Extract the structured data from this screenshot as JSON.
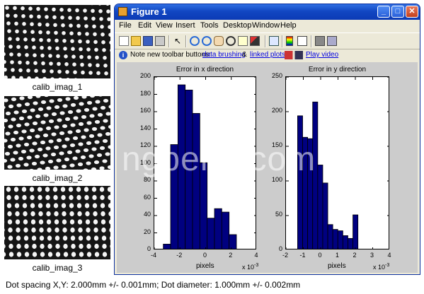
{
  "thumbnails": [
    {
      "caption": "calib_imag_1"
    },
    {
      "caption": "calib_imag_2"
    },
    {
      "caption": "calib_imag_3"
    }
  ],
  "caption": "Dot spacing X,Y: 2.000mm +/- 0.001mm;  Dot diameter: 1.000mm +/- 0.002mm",
  "watermark": "ngpeng.com",
  "window": {
    "title": "Figure 1",
    "controls": {
      "minimize": "_",
      "maximize": "□",
      "close": "✕"
    },
    "menu": [
      "File",
      "Edit",
      "View",
      "Insert",
      "Tools",
      "Desktop",
      "Window",
      "Help"
    ],
    "toolbar_icons": [
      "new-file-icon",
      "open-folder-icon",
      "save-icon",
      "print-icon",
      "pointer-icon",
      "zoom-in-icon",
      "zoom-out-icon",
      "pan-hand-icon",
      "rotate-3d-icon",
      "data-cursor-icon",
      "brush-icon",
      "link-icon",
      "colorbar-icon",
      "legend-icon",
      "hide-plot-tools-icon",
      "show-plot-tools-icon"
    ],
    "note": {
      "prefix": "Note new toolbar buttons: ",
      "link1": "data brushing",
      "amp": " & ",
      "link2": "linked plots",
      "video": "Play video"
    }
  },
  "colors": {
    "bar_fill": "#000080",
    "bar_edge": "#000000",
    "figure_bg": "#cccccc",
    "titlebar": "#1247c2"
  },
  "chart_data": [
    {
      "type": "bar",
      "title": "Error in x direction",
      "xlabel": "pixels",
      "ylabel": "",
      "x_multiplier": "x 10",
      "x_multiplier_exp": "-3",
      "xlim": [
        -4,
        4
      ],
      "ylim": [
        0,
        200
      ],
      "xticks": [
        "-4",
        "-2",
        "0",
        "2",
        "4"
      ],
      "yticks": [
        "0",
        "20",
        "40",
        "60",
        "80",
        "100",
        "120",
        "140",
        "160",
        "180",
        "200"
      ],
      "bin_edges": [
        -3.3,
        -2.73,
        -2.16,
        -1.59,
        -1.02,
        -0.45,
        0.12,
        0.69,
        1.26,
        1.83
      ],
      "values": [
        7,
        122,
        191,
        185,
        158,
        101,
        37,
        48,
        44,
        18
      ]
    },
    {
      "type": "bar",
      "title": "Error in y direction",
      "xlabel": "pixels",
      "ylabel": "",
      "x_multiplier": "x 10",
      "x_multiplier_exp": "-3",
      "xlim": [
        -2,
        4
      ],
      "ylim": [
        0,
        250
      ],
      "xticks": [
        "-2",
        "-1",
        "0",
        "1",
        "2",
        "3",
        "4"
      ],
      "yticks": [
        "0",
        "50",
        "100",
        "150",
        "200",
        "250"
      ],
      "bin_edges": [
        -1.33,
        -1.04,
        -0.75,
        -0.46,
        -0.17,
        0.12,
        0.41,
        0.7,
        0.99,
        1.28,
        1.57,
        1.86,
        2.15,
        2.44
      ],
      "values": [
        194,
        163,
        161,
        214,
        123,
        97,
        37,
        30,
        28,
        21,
        17,
        51
      ]
    }
  ]
}
